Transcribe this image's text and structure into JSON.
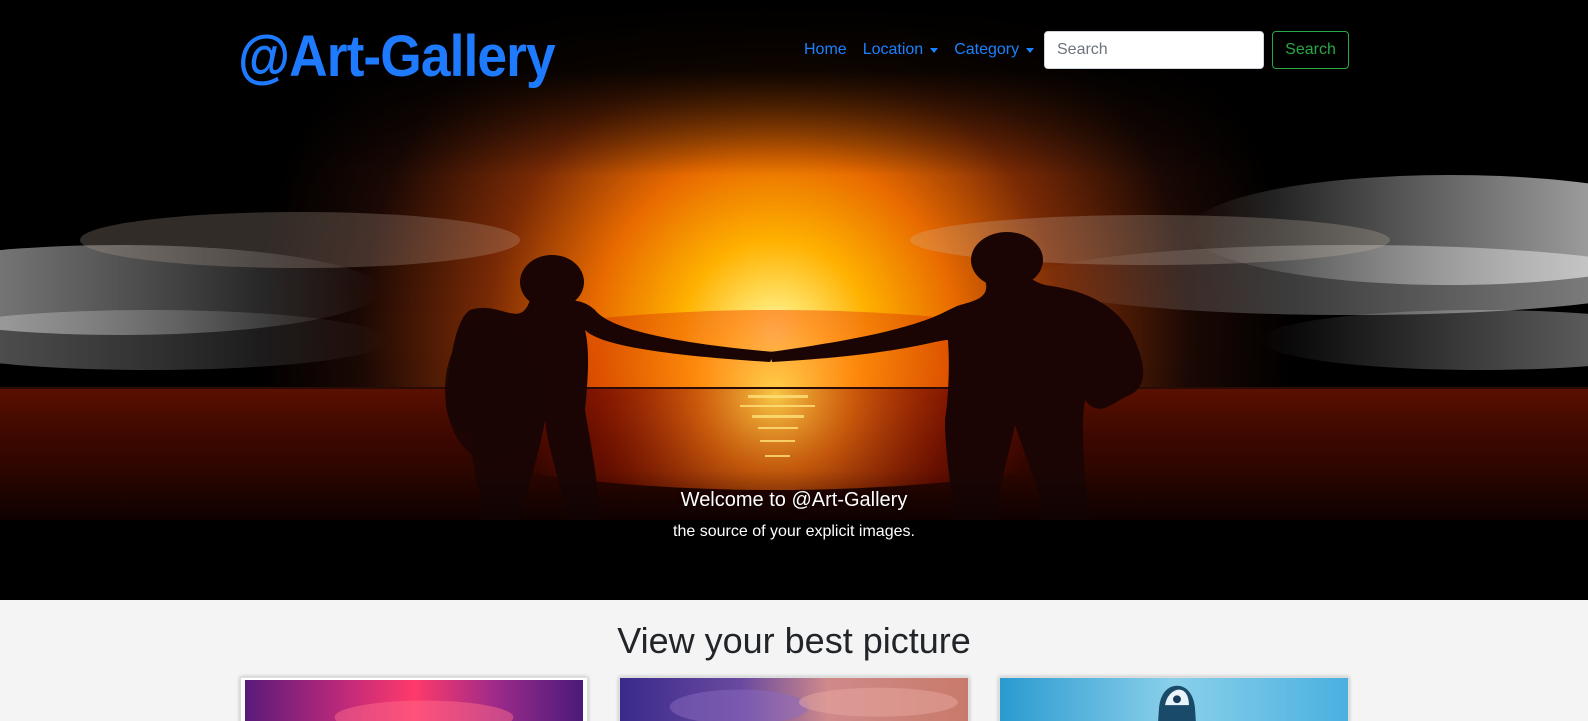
{
  "brand": {
    "title": "@Art-Gallery"
  },
  "nav": {
    "home": "Home",
    "location": "Location",
    "category": "Category"
  },
  "search": {
    "placeholder": "Search",
    "button": "Search"
  },
  "hero": {
    "caption_title": "Welcome to @Art-Gallery",
    "caption_text": "the source of your explicit images."
  },
  "gallery": {
    "title": "View your best picture"
  },
  "colors": {
    "brand": "#1e7bff",
    "nav_link": "#1a82ff",
    "search_button": "#28a745",
    "hero_background": "#000000",
    "section_background": "#f4f4f4"
  }
}
